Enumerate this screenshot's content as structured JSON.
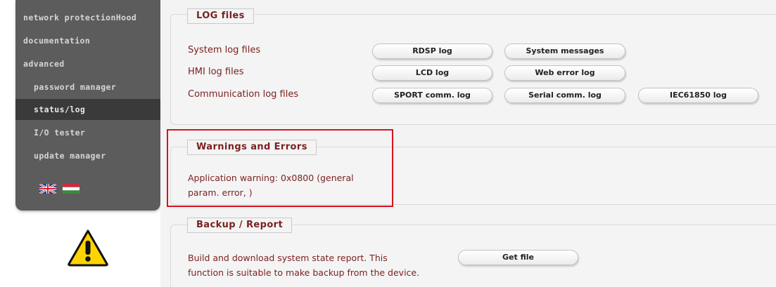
{
  "sidebar": {
    "items": [
      {
        "label": "network protectionHood"
      },
      {
        "label": "documentation"
      },
      {
        "label": "advanced"
      },
      {
        "label": "password manager"
      },
      {
        "label": "status/log"
      },
      {
        "label": "I/O tester"
      },
      {
        "label": "update manager"
      }
    ],
    "active_item": "status/log"
  },
  "log_files": {
    "title": "LOG files",
    "rows": [
      {
        "label": "System log files",
        "buttons": [
          "RDSP log",
          "System messages"
        ]
      },
      {
        "label": "HMI log files",
        "buttons": [
          "LCD log",
          "Web error log"
        ]
      },
      {
        "label": "Communication log files",
        "buttons": [
          "SPORT comm. log",
          "Serial comm. log",
          "IEC61850 log"
        ]
      }
    ]
  },
  "warnings": {
    "title": "Warnings and Errors",
    "message_line1": "Application warning: 0x0800 (general",
    "message_line2": "param. error, )"
  },
  "backup": {
    "title": "Backup / Report",
    "text_line1": "Build and download system state report. This",
    "text_line2": "function is suitable to make backup from the device.",
    "button": "Get file"
  },
  "colors": {
    "sidebar_bg": "#5c5c5c",
    "sidebar_active_bg": "#3a3a3a",
    "accent_text": "#7a1f1f",
    "highlight_border": "#d9121f"
  },
  "icons": [
    "uk-flag-icon",
    "hungary-flag-icon",
    "warning-icon"
  ]
}
